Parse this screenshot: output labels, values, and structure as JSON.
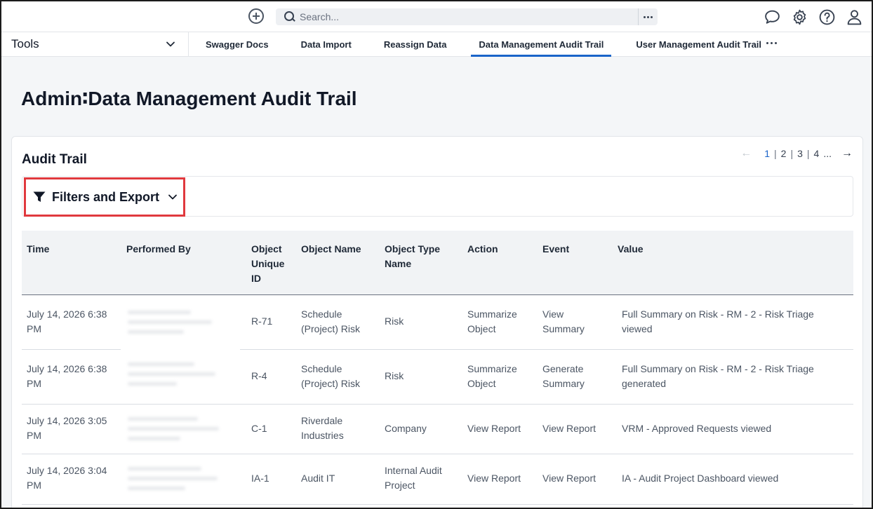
{
  "topbar": {
    "search_placeholder": "Search...",
    "icons": [
      "add-circle-icon",
      "search-icon",
      "more-horizontal-icon",
      "chat-icon",
      "gear-icon",
      "help-icon",
      "user-icon"
    ]
  },
  "toolsbar": {
    "label": "Tools",
    "tabs": [
      {
        "label": "Swagger Docs",
        "active": false
      },
      {
        "label": "Data Import",
        "active": false
      },
      {
        "label": "Reassign Data",
        "active": false
      },
      {
        "label": "Data Management Audit Trail",
        "active": true
      },
      {
        "label": "User Management Audit Trail",
        "active": false
      }
    ]
  },
  "page": {
    "title": "Admin∶Data Management Audit Trail"
  },
  "card": {
    "title": "Audit Trail",
    "pager": {
      "pages": [
        "1",
        "2",
        "3",
        "4"
      ],
      "current": "1",
      "ellipsis": "..."
    },
    "filter_label": "Filters and Export"
  },
  "table": {
    "headers": [
      "Time",
      "Performed By",
      "Object Unique ID",
      "Object Name",
      "Object Type Name",
      "Action",
      "Event",
      "Value"
    ],
    "rows": [
      {
        "time": "July 14, 2026 6:38 PM",
        "id": "R-71",
        "object_name": "Schedule (Project) Risk",
        "object_type": "Risk",
        "action": "Summarize Object",
        "event": "View Summary",
        "value": "Full Summary on Risk - RM - 2 - Risk Triage viewed"
      },
      {
        "time": "July 14, 2026 6:38 PM",
        "id": "R-4",
        "object_name": "Schedule (Project) Risk",
        "object_type": "Risk",
        "action": "Summarize Object",
        "event": "Generate Summary",
        "value": "Full Summary on Risk - RM - 2 - Risk Triage generated"
      },
      {
        "time": "July 14, 2026 3:05 PM",
        "id": "C-1",
        "object_name": "Riverdale Industries",
        "object_type": "Company",
        "action": "View Report",
        "event": "View Report",
        "value": "VRM - Approved Requests viewed"
      },
      {
        "time": "July 14, 2026 3:04 PM",
        "id": "IA-1",
        "object_name": "Audit IT",
        "object_type": "Internal Audit Project",
        "action": "View Report",
        "event": "View Report",
        "value": "IA - Audit Project Dashboard viewed"
      }
    ]
  },
  "colors": {
    "accent": "#1a64c9",
    "highlight_border": "#e0393e"
  }
}
